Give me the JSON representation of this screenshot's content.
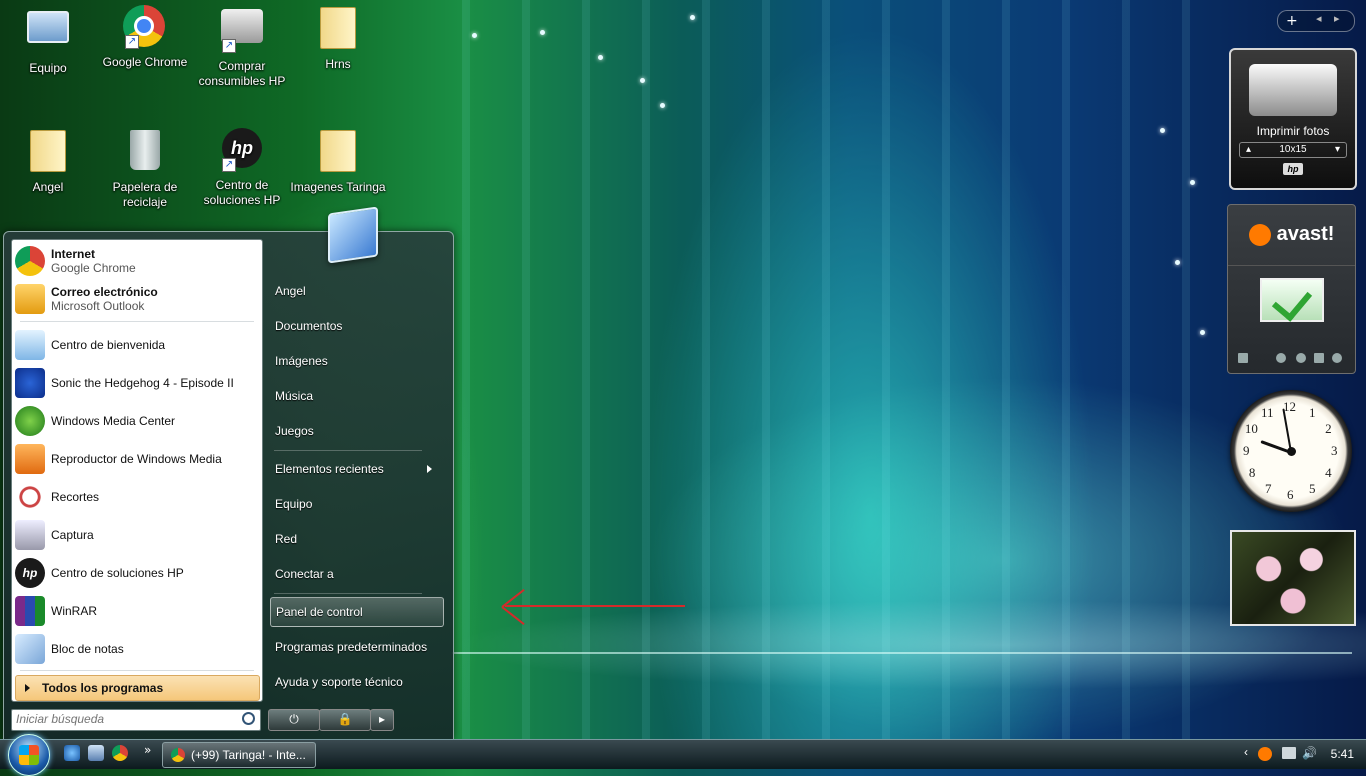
{
  "desktop": {
    "icons": [
      {
        "label": "Equipo"
      },
      {
        "label": "Google Chrome"
      },
      {
        "label": "Comprar consumibles HP"
      },
      {
        "label": "Hrns"
      },
      {
        "label": "Angel"
      },
      {
        "label": "Papelera de reciclaje"
      },
      {
        "label": "Centro de soluciones HP"
      },
      {
        "label": "Imagenes Taringa"
      }
    ]
  },
  "start_menu": {
    "pinned": [
      {
        "title": "Internet",
        "subtitle": "Google Chrome",
        "icon": "chrome-icon"
      },
      {
        "title": "Correo electrónico",
        "subtitle": "Microsoft Outlook",
        "icon": "outlook-icon"
      }
    ],
    "recent": [
      {
        "label": "Centro de bienvenida",
        "icon": "welcome-center-icon"
      },
      {
        "label": "Sonic the Hedgehog 4 - Episode II",
        "icon": "sonic-icon"
      },
      {
        "label": "Windows Media Center",
        "icon": "media-center-icon"
      },
      {
        "label": "Reproductor de Windows Media",
        "icon": "media-player-icon"
      },
      {
        "label": "Recortes",
        "icon": "snipping-tool-icon"
      },
      {
        "label": "Captura",
        "icon": "camera-icon"
      },
      {
        "label": "Centro de soluciones HP",
        "icon": "hp-icon"
      },
      {
        "label": "WinRAR",
        "icon": "winrar-icon"
      },
      {
        "label": "Bloc de notas",
        "icon": "notepad-icon"
      }
    ],
    "all_programs": "Todos los programas",
    "search_placeholder": "Iniciar búsqueda",
    "right": [
      "Angel",
      "Documentos",
      "Imágenes",
      "Música",
      "Juegos",
      "Elementos recientes",
      "Equipo",
      "Red",
      "Conectar a",
      "Panel de control",
      "Programas predeterminados",
      "Ayuda y soporte técnico"
    ],
    "selected": "Panel de control"
  },
  "taskbar": {
    "window_button": "(+99) Taringa! - Inte...",
    "clock": "5:41",
    "overflow": "»"
  },
  "gadgets": {
    "printer": {
      "title": "Imprimir fotos",
      "size": "10x15",
      "brand": "hp"
    },
    "avast": {
      "brand": "avast!"
    },
    "clock_numbers": [
      "12",
      "1",
      "2",
      "3",
      "4",
      "5",
      "6",
      "7",
      "8",
      "9",
      "10",
      "11"
    ]
  }
}
